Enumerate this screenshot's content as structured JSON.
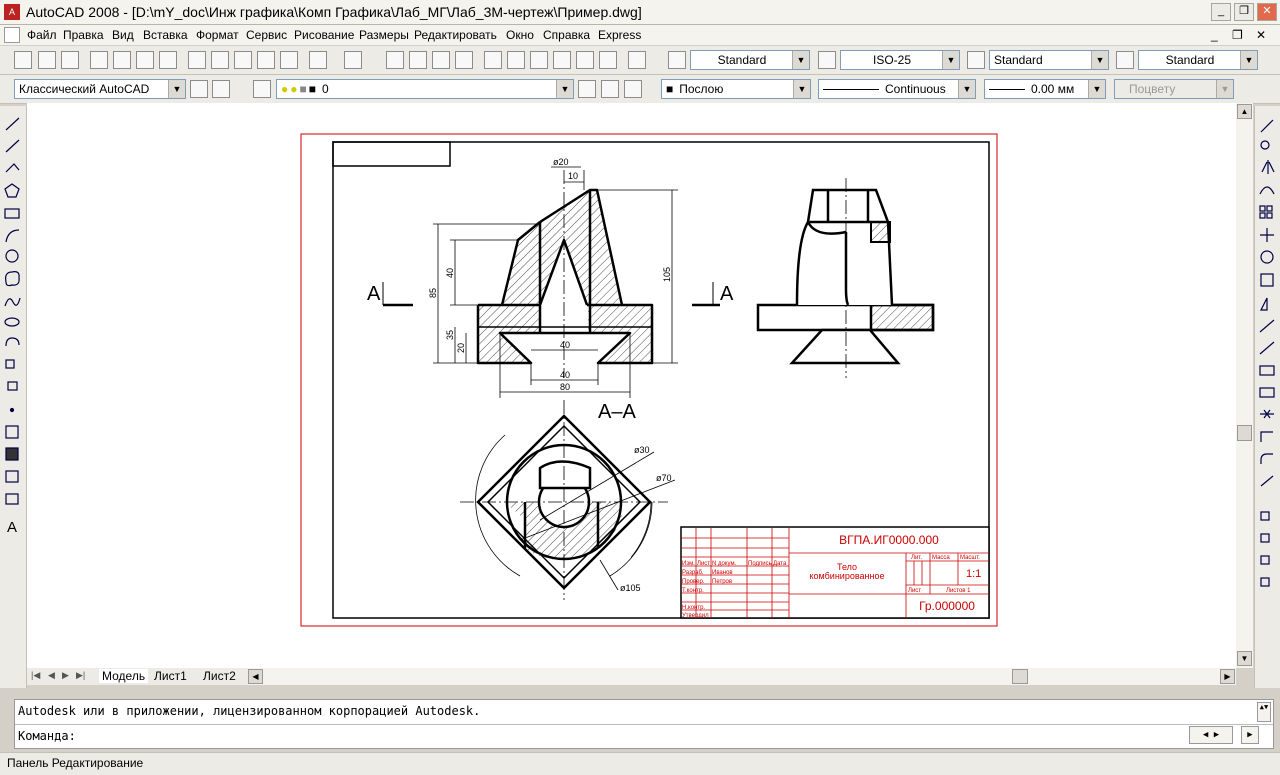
{
  "window": {
    "title": "AutoCAD 2008 - [D:\\mY_doc\\Инж графика\\Комп Графика\\Лаб_МГ\\Лаб_3М-чертеж\\Пример.dwg]",
    "app_icon": "A",
    "minimize": "_",
    "restore": "❐",
    "close": "✕"
  },
  "menu": {
    "items": [
      "Файл",
      "Правка",
      "Вид",
      "Вставка",
      "Формат",
      "Сервис",
      "Рисование",
      "Размеры",
      "Редактировать",
      "Окно",
      "Справка",
      "Express"
    ]
  },
  "styles_toolbar": {
    "text_style": "Standard",
    "dim_style": "ISO-25",
    "table_style": "Standard",
    "mleader_style": "Standard"
  },
  "layers_toolbar": {
    "workspace": "Классический AutoCAD",
    "layer": "0",
    "color": "Послою",
    "linetype": "Continuous",
    "lineweight": "0.00 мм",
    "plotstyle": "Поцвету"
  },
  "tabs": [
    "Модель",
    "Лист1",
    "Лист2"
  ],
  "command": {
    "history": "Autodesk или в приложении, лицензированном корпорацией Autodesk.",
    "prompt": "Команда:"
  },
  "status": {
    "panel": "Панель Редактирование"
  },
  "drawing": {
    "dims": {
      "d20": "ø20",
      "d10": "10",
      "d40_top": "40",
      "d85": "85",
      "d35": "35",
      "d20_left": "20",
      "d40_in": "40",
      "d40_bot": "40",
      "d80": "80",
      "d105": "105",
      "d30": "ø30",
      "d70": "ø70",
      "d105_circ": "ø105"
    },
    "section_labels": {
      "left": "A",
      "right": "A",
      "title": "A–A"
    },
    "title_block": {
      "designation": "ВГПА.ИГ0000.000",
      "part_name_1": "Тело",
      "part_name_2": "комбинированное",
      "letter_hdr": "Лит.",
      "mass_hdr": "Масса",
      "scale_hdr": "Масшт.",
      "scale_val": "1:1",
      "sheet_hdr": "Лист",
      "sheets_hdr": "Листов 1",
      "group": "Гр.000000",
      "row_izm": "Изм.",
      "row_list": "Лист",
      "row_doc": "N докум.",
      "row_sign": "Подпись",
      "row_date": "Дата",
      "razrab": "Разраб.",
      "razrab_name": "Иванов",
      "prov": "Провер.",
      "prov_name": "Петров",
      "tkontr": "Т.контр.",
      "nkontr": "Н.контр.",
      "utv": "Утвердил"
    }
  },
  "colors": {
    "frame_red": "#cc0000",
    "titleblock_red": "#cc0000"
  }
}
